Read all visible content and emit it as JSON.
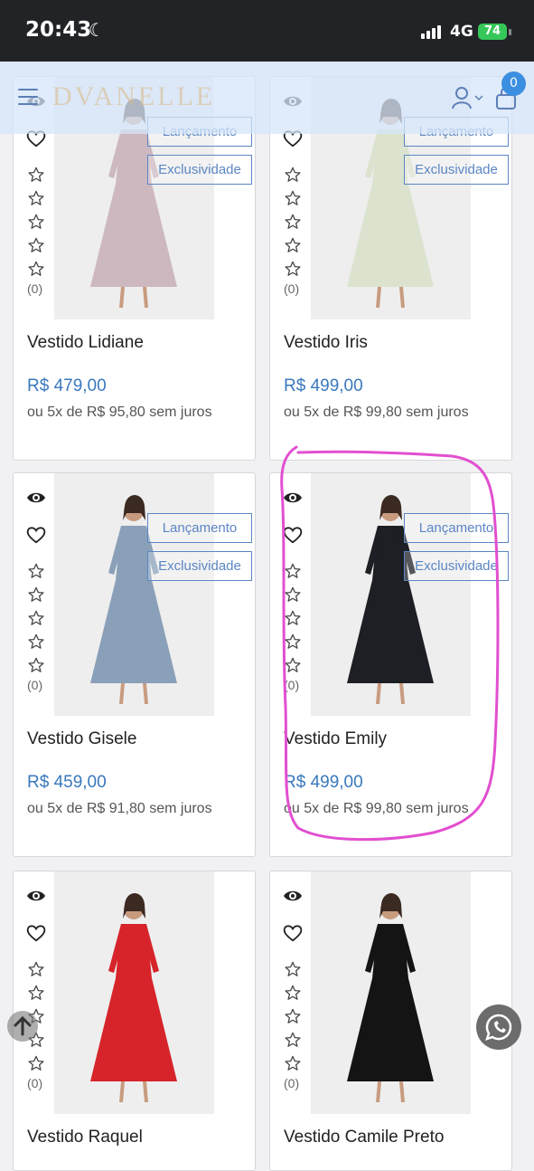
{
  "status_bar": {
    "time": "20:43",
    "network": "4G",
    "battery": "74"
  },
  "header": {
    "logo_text": "DVANELLE",
    "cart_count": "0"
  },
  "products": [
    {
      "name": "Vestido Lidiane",
      "price": "R$ 479,00",
      "installments": "ou 5x de R$ 95,80 sem juros",
      "rating_count": "(0)",
      "badges": [
        "Lançamento",
        "Exclusividade"
      ],
      "dress_color": "#cdb8c0"
    },
    {
      "name": "Vestido Iris",
      "price": "R$ 499,00",
      "installments": "ou 5x de R$ 99,80 sem juros",
      "rating_count": "(0)",
      "badges": [
        "Lançamento",
        "Exclusividade"
      ],
      "dress_color": "#dbe3cf"
    },
    {
      "name": "Vestido Gisele",
      "price": "R$ 459,00",
      "installments": "ou 5x de R$ 91,80 sem juros",
      "rating_count": "(0)",
      "badges": [
        "Lançamento",
        "Exclusividade"
      ],
      "dress_color": "#8aa0b8"
    },
    {
      "name": "Vestido Emily",
      "price": "R$ 499,00",
      "installments": "ou 5x de R$ 99,80 sem juros",
      "rating_count": "(0)",
      "badges": [
        "Lançamento",
        "Exclusividade"
      ],
      "dress_color": "#1d1f24"
    },
    {
      "name": "Vestido Raquel",
      "price": "",
      "installments": "",
      "rating_count": "(0)",
      "badges": [],
      "dress_color": "#d6242a"
    },
    {
      "name": "Vestido Camile Preto",
      "price": "",
      "installments": "",
      "rating_count": "(0)",
      "badges": [],
      "dress_color": "#141414"
    }
  ],
  "annotation_color": "#e24fd0",
  "icons": {
    "menu": "hamburger-icon",
    "user": "user-icon",
    "cart": "shopping-bag-icon",
    "view": "eye-icon",
    "wishlist": "heart-icon",
    "rating": "star-icon",
    "scroll_top": "arrow-up-icon",
    "chat": "whatsapp-icon"
  }
}
